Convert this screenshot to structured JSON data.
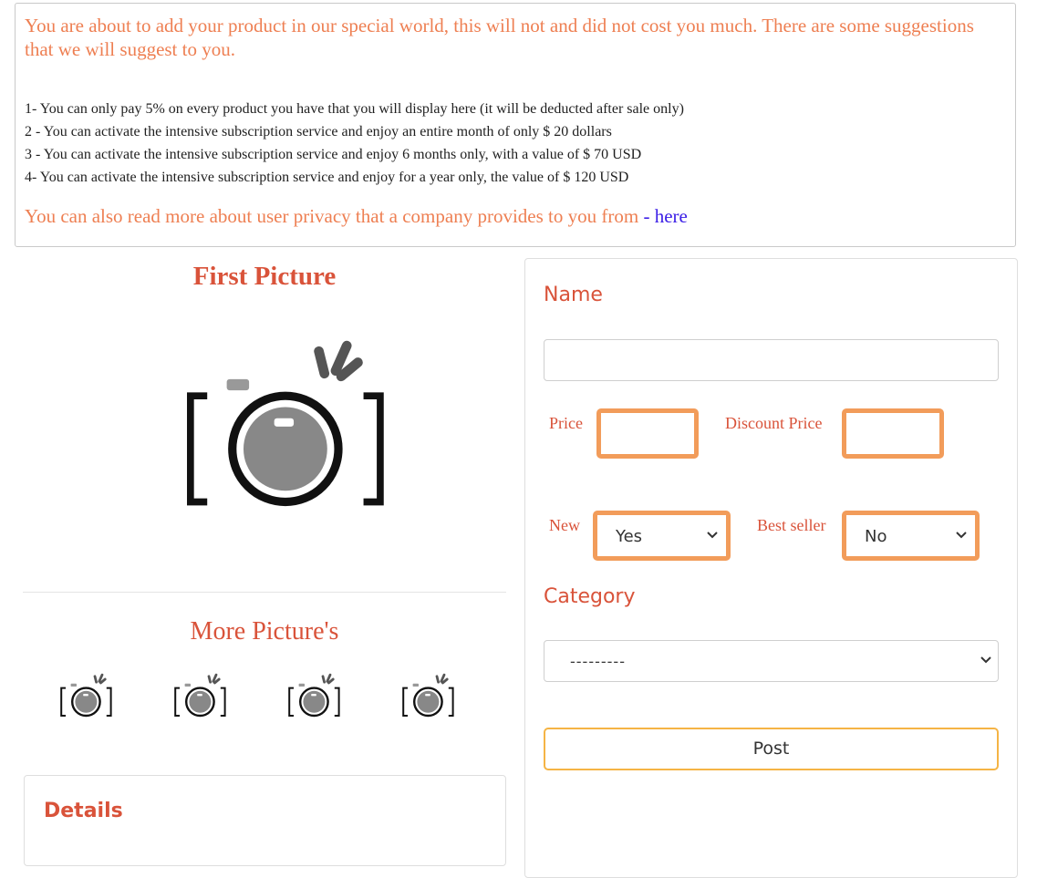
{
  "notice": {
    "intro": "You are about to add your product in our special world, this will not and did not cost you much. There are some suggestions that we will suggest to you.",
    "rules": [
      "1- You can only pay 5% on every product you have that you will display here (it will be deducted after sale only)",
      "2 - You can activate the intensive subscription service and enjoy an entire month of only $ 20 dollars",
      "3 - You can activate the intensive subscription service and enjoy 6 months only, with a value of $ 70 USD",
      "4- You can activate the intensive subscription service and enjoy for a year only, the value of $ 120 USD"
    ],
    "privacy_text": "You can also read more about user privacy that a company provides to you from",
    "privacy_link": "- here"
  },
  "pictures": {
    "first_title": "First Picture",
    "more_title": "More Picture's",
    "photo_icon": "camera-icon"
  },
  "details": {
    "title": "Details"
  },
  "form": {
    "name_label": "Name",
    "name_value": "",
    "price_label": "Price",
    "price_value": "",
    "discount_label": "Discount Price",
    "discount_value": "",
    "new_label": "New",
    "new_value": "Yes",
    "best_seller_label": "Best seller",
    "best_seller_value": "No",
    "category_label": "Category",
    "category_value": "---------",
    "post_label": "Post"
  },
  "colors": {
    "accent_text": "#ee7f52",
    "label_red": "#d9533a",
    "input_orange": "#f29c5a",
    "button_border": "#f5b445",
    "link_blue": "#3a1de6"
  }
}
